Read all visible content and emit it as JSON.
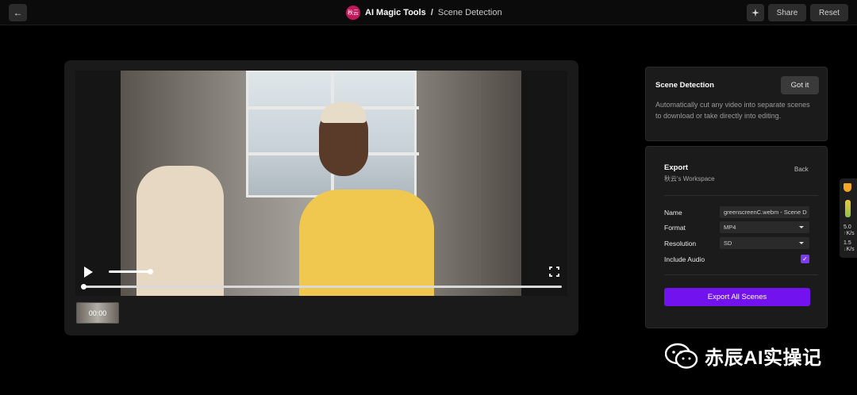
{
  "topbar": {
    "back_icon": "arrow-left-icon",
    "brand_avatar_text": "秋云",
    "app_title": "AI Magic Tools",
    "separator": "/",
    "page_title": "Scene Detection",
    "magic_icon": "sparkle-icon",
    "share_label": "Share",
    "reset_label": "Reset"
  },
  "player": {
    "thumbnail_time": "00:00",
    "play_icon": "play-icon",
    "fullscreen_icon": "fullscreen-icon",
    "progress": 0,
    "volume": 1
  },
  "info_card": {
    "title": "Scene Detection",
    "button_label": "Got it",
    "description": "Automatically cut any video into separate scenes to download or take directly into editing."
  },
  "export": {
    "title": "Export",
    "workspace": "秋云's Workspace",
    "back_label": "Back",
    "name_label": "Name",
    "name_value": "greenscreenC.webm - Scene D",
    "format_label": "Format",
    "format_value": "MP4",
    "resolution_label": "Resolution",
    "resolution_value": "SD",
    "audio_label": "Include Audio",
    "audio_checked": true,
    "export_button": "Export All Scenes",
    "accent_color": "#7112ef"
  },
  "side_widget": {
    "stat1_value": "5.0",
    "stat1_unit": "K/s",
    "stat2_value": "1.5",
    "stat2_unit": "K/s"
  },
  "watermark": {
    "text": "赤辰AI实操记",
    "icon": "wechat-icon"
  }
}
